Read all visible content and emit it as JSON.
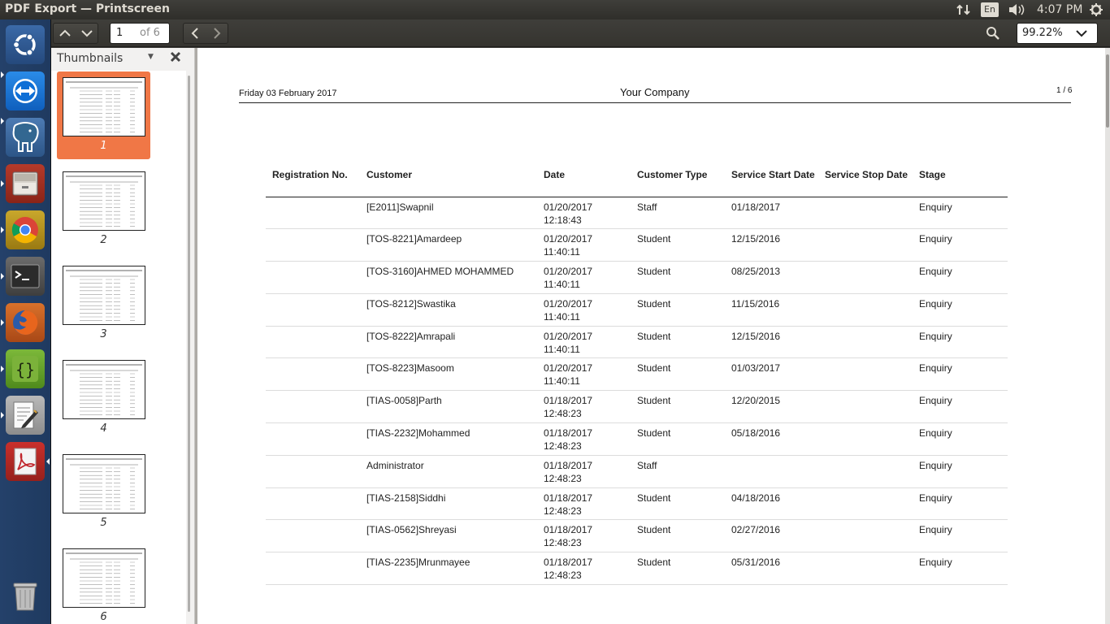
{
  "window": {
    "title": "PDF Export — Printscreen"
  },
  "panel": {
    "keyboard_layout": "En",
    "clock": "4:07 PM"
  },
  "launcher": {
    "items": [
      "Ubuntu Dash",
      "TeamViewer",
      "pgAdmin",
      "Files",
      "Chrome",
      "Terminal",
      "Firefox",
      "Brackets",
      "Text Editor",
      "PDF Viewer",
      "Trash"
    ]
  },
  "toolbar": {
    "current_page": "1",
    "of_pages": "of 6",
    "zoom": "99.22%"
  },
  "sidebar": {
    "title": "Thumbnails",
    "thumbnails": [
      "1",
      "2",
      "3",
      "4",
      "5",
      "6"
    ]
  },
  "document": {
    "header_date": "Friday 03 February 2017",
    "header_company": "Your Company",
    "header_pages": "1 / 6",
    "columns": [
      "Registration No.",
      "Customer",
      "Date",
      "Customer Type",
      "Service Start Date",
      "Service Stop Date",
      "Stage"
    ],
    "rows": [
      {
        "reg": "",
        "customer": "[E2011]Swapnil",
        "date": "01/20/2017",
        "time": "12:18:43",
        "type": "Staff",
        "start": "01/18/2017",
        "stop": "",
        "stage": "Enquiry"
      },
      {
        "reg": "",
        "customer": "[TOS-8221]Amardeep",
        "date": "01/20/2017",
        "time": "11:40:11",
        "type": "Student",
        "start": "12/15/2016",
        "stop": "",
        "stage": "Enquiry"
      },
      {
        "reg": "",
        "customer": "[TOS-3160]AHMED MOHAMMED",
        "date": "01/20/2017",
        "time": "11:40:11",
        "type": "Student",
        "start": "08/25/2013",
        "stop": "",
        "stage": "Enquiry"
      },
      {
        "reg": "",
        "customer": "[TOS-8212]Swastika",
        "date": "01/20/2017",
        "time": "11:40:11",
        "type": "Student",
        "start": "11/15/2016",
        "stop": "",
        "stage": "Enquiry"
      },
      {
        "reg": "",
        "customer": "[TOS-8222]Amrapali",
        "date": "01/20/2017",
        "time": "11:40:11",
        "type": "Student",
        "start": "12/15/2016",
        "stop": "",
        "stage": "Enquiry"
      },
      {
        "reg": "",
        "customer": "[TOS-8223]Masoom",
        "date": "01/20/2017",
        "time": "11:40:11",
        "type": "Student",
        "start": "01/03/2017",
        "stop": "",
        "stage": "Enquiry"
      },
      {
        "reg": "",
        "customer": "[TIAS-0058]Parth",
        "date": "01/18/2017",
        "time": "12:48:23",
        "type": "Student",
        "start": "12/20/2015",
        "stop": "",
        "stage": "Enquiry"
      },
      {
        "reg": "",
        "customer": "[TIAS-2232]Mohammed",
        "date": "01/18/2017",
        "time": "12:48:23",
        "type": "Student",
        "start": "05/18/2016",
        "stop": "",
        "stage": "Enquiry"
      },
      {
        "reg": "",
        "customer": "Administrator",
        "date": "01/18/2017",
        "time": "12:48:23",
        "type": "Staff",
        "start": "",
        "stop": "",
        "stage": "Enquiry"
      },
      {
        "reg": "",
        "customer": "[TIAS-2158]Siddhi",
        "date": "01/18/2017",
        "time": "12:48:23",
        "type": "Student",
        "start": "04/18/2016",
        "stop": "",
        "stage": "Enquiry"
      },
      {
        "reg": "",
        "customer": "[TIAS-0562]Shreyasi",
        "date": "01/18/2017",
        "time": "12:48:23",
        "type": "Student",
        "start": "02/27/2016",
        "stop": "",
        "stage": "Enquiry"
      },
      {
        "reg": "",
        "customer": "[TIAS-2235]Mrunmayee",
        "date": "01/18/2017",
        "time": "12:48:23",
        "type": "Student",
        "start": "05/31/2016",
        "stop": "",
        "stage": "Enquiry"
      }
    ]
  }
}
